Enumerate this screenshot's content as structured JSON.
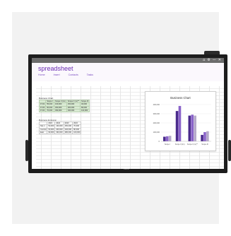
{
  "app": {
    "title": "spreadsheet",
    "menu": [
      "Home",
      "Insert",
      "Contacts",
      "Tasks"
    ],
    "window_controls": [
      "⌂",
      "⚙",
      "—",
      "✕"
    ]
  },
  "monitor": {
    "brand_label": "DELL"
  },
  "table_green": {
    "title": "Business Chart",
    "header": [
      "",
      "Scope I",
      "Scope II (tm)",
      "Scope II (m)**",
      "Scope III"
    ],
    "rows": [
      [
        "FY22",
        "55,000",
        "160,000",
        "150,000",
        "40,000"
      ],
      [
        "FY23",
        "60,000",
        "300,000",
        "260,000",
        "80,000"
      ],
      [
        "FY24",
        "70,000",
        "390,000",
        "340,000",
        "110,000"
      ]
    ]
  },
  "table_plain": {
    "title": "Business Emission",
    "header": [
      "",
      "2021",
      "2022",
      "2023",
      "2024"
    ],
    "rows": [
      [
        "Site 1",
        "50,000",
        "100,000",
        "150,000",
        "70,000"
      ],
      [
        "Central",
        "60,000",
        "200,000",
        "240,000",
        "80,000"
      ],
      [
        "East",
        "90,000",
        "330,000",
        "280,000",
        "100,000"
      ]
    ]
  },
  "chart_data": {
    "type": "bar",
    "title": "Business Chart",
    "categories": [
      "Scope I",
      "Scope II (tm)",
      "Scope II (m)**",
      "Scope III"
    ],
    "ytick_labels": [
      "400,000",
      "300,000",
      "200,000",
      "100,000",
      "0"
    ],
    "ylim": [
      0,
      400000
    ],
    "series": [
      {
        "values": [
          50000,
          330000,
          280000,
          70000
        ]
      },
      {
        "values": [
          55000,
          385000,
          290000,
          100000
        ]
      },
      {
        "values": [
          60000,
          0,
          280000,
          110000
        ]
      }
    ],
    "colors": [
      "#4a2a8c",
      "#8a63c9",
      "#b4a8c9"
    ],
    "grid": true
  }
}
